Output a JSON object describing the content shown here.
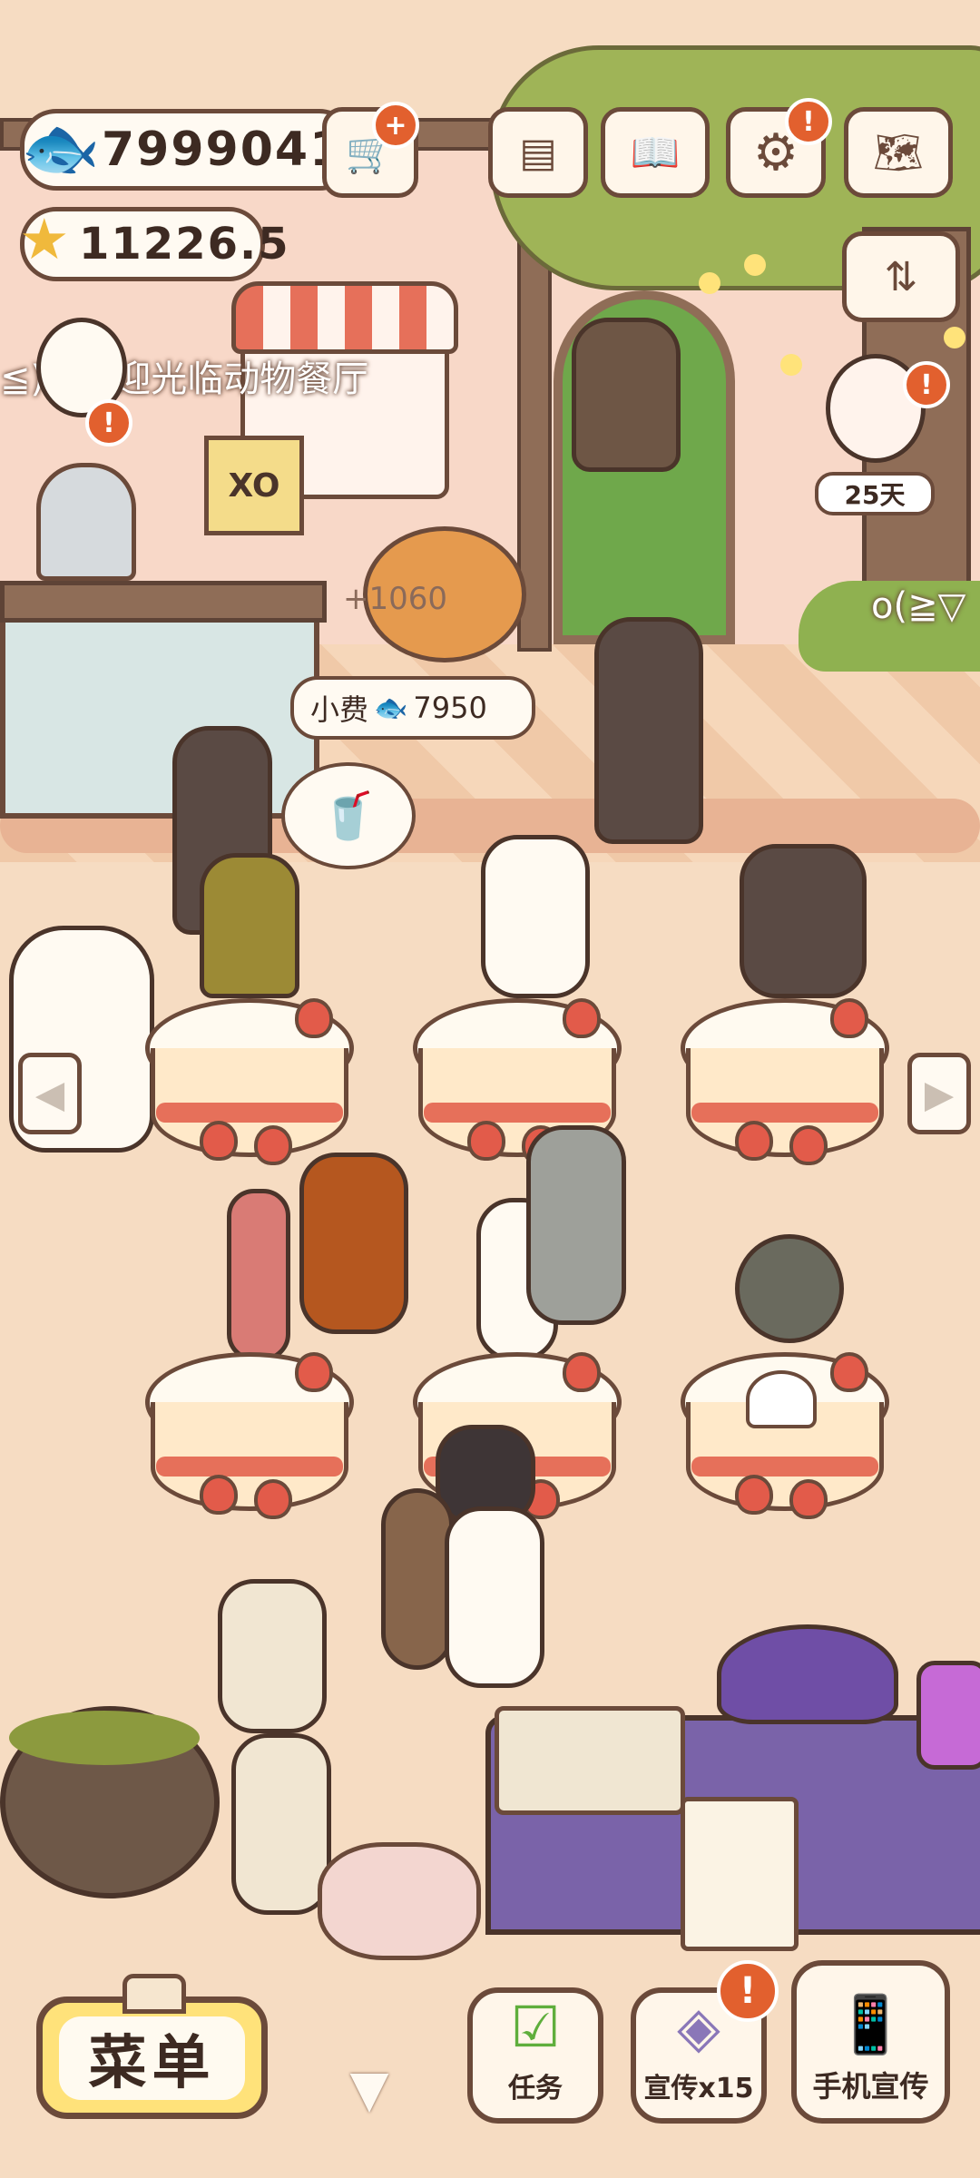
{
  "hud": {
    "fish_coins": "7999041",
    "stars": "11226.5",
    "fish_icon": "fish-icon",
    "star_icon": "star-icon",
    "cart_icon": "shopping-cart-plus-icon"
  },
  "top_icons": [
    {
      "name": "profile-card-icon",
      "glyph": "▤"
    },
    {
      "name": "recipe-book-icon",
      "glyph": "📖"
    },
    {
      "name": "settings-gear-icon",
      "glyph": "⚙"
    },
    {
      "name": "map-icon",
      "glyph": "🗺"
    }
  ],
  "scene": {
    "marquee_text": "≦)o 欢迎光临动物餐厅",
    "marquee_text_right": "o(≧▽",
    "earned_popup": "+1060",
    "tip_label": "小费",
    "tip_value": "7950",
    "visitor_days": "25天",
    "sign_text": "XO"
  },
  "bottom_bar": {
    "menu_label": "菜单",
    "tasks_label": "任务",
    "promo_label": "宣传x15",
    "phone_promo_label": "手机宣传"
  },
  "colors": {
    "background": "#f6dcc2",
    "outline": "#6b4a3a",
    "alert": "#e2602e",
    "menu_button": "#ffe27a"
  }
}
